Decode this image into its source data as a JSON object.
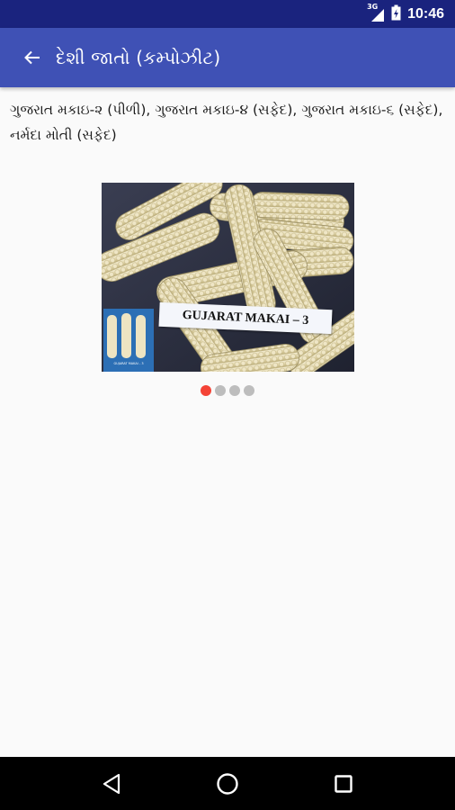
{
  "status_bar": {
    "network": "3G",
    "time": "10:46"
  },
  "app_bar": {
    "title": "દેશી જાતો (કમ્પોઝીટ)",
    "back_icon": "arrow-back-icon"
  },
  "content": {
    "varieties_text": "ગુજરાત મકાઇ-૨ (પીળી), ગુજરાત મકાઇ-૪ (સફેદ), ગુજરાત મકાઇ-૬ (સફેદ), નર્મદા મોતી (સફેદ)",
    "image_slider": {
      "slide_label": "GUJARAT MAKAI – 3",
      "inset_caption": "GUJARAT MAKAI - 3",
      "slide_count": 4,
      "active_index": 0
    }
  },
  "nav_bar": {
    "back_icon": "nav-back-icon",
    "home_icon": "nav-home-icon",
    "recents_icon": "nav-recents-icon"
  },
  "colors": {
    "status_bar": "#1a237e",
    "app_bar": "#3f51b5",
    "active_dot": "#f44336",
    "inactive_dot": "#bdbdbd"
  }
}
